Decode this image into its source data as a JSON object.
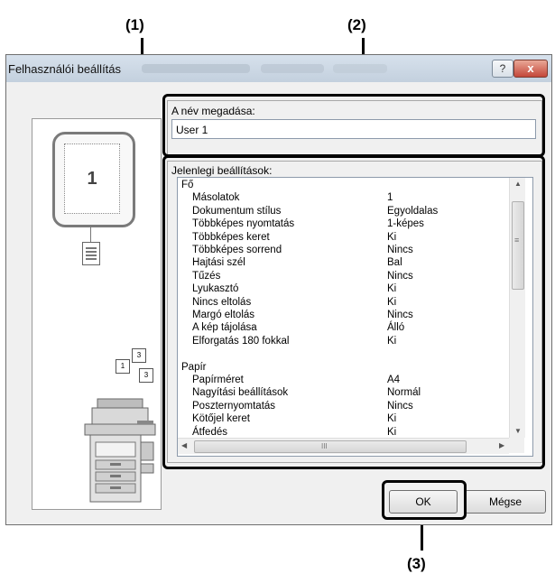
{
  "callouts": {
    "c1": "(1)",
    "c2": "(2)",
    "c3": "(3)"
  },
  "window": {
    "title": "Felhasználói beállítás",
    "help_glyph": "?",
    "close_glyph": "x"
  },
  "preview": {
    "page_number": "1"
  },
  "name_section": {
    "label": "A név megadása:",
    "value": "User 1"
  },
  "settings_section": {
    "label": "Jelenlegi beállítások:",
    "rows": [
      {
        "name": "Fő",
        "value": "",
        "indent": 0
      },
      {
        "name": "Másolatok",
        "value": "1",
        "indent": 1
      },
      {
        "name": "Dokumentum stílus",
        "value": "Egyoldalas",
        "indent": 1
      },
      {
        "name": "Többképes nyomtatás",
        "value": "1-képes",
        "indent": 1
      },
      {
        "name": "Többképes keret",
        "value": "Ki",
        "indent": 1
      },
      {
        "name": "Többképes sorrend",
        "value": "Nincs",
        "indent": 1
      },
      {
        "name": "Hajtási szél",
        "value": "Bal",
        "indent": 1
      },
      {
        "name": "Tűzés",
        "value": "Nincs",
        "indent": 1
      },
      {
        "name": "Lyukasztó",
        "value": "Ki",
        "indent": 1
      },
      {
        "name": "Nincs eltolás",
        "value": "Ki",
        "indent": 1
      },
      {
        "name": "Margó eltolás",
        "value": "Nincs",
        "indent": 1
      },
      {
        "name": "A kép tájolása",
        "value": "Álló",
        "indent": 1
      },
      {
        "name": "Elforgatás 180 fokkal",
        "value": "Ki",
        "indent": 1
      },
      {
        "name": "",
        "value": "",
        "indent": 0
      },
      {
        "name": "Papír",
        "value": "",
        "indent": 0
      },
      {
        "name": "Papírméret",
        "value": "A4",
        "indent": 1
      },
      {
        "name": "Nagyítási beállítások",
        "value": "Normál",
        "indent": 1
      },
      {
        "name": "Poszternyomtatás",
        "value": "Nincs",
        "indent": 1
      },
      {
        "name": "Kötőjel keret",
        "value": "Ki",
        "indent": 1
      },
      {
        "name": "Átfedés",
        "value": "Ki",
        "indent": 1
      }
    ],
    "hscroll_grip": "III"
  },
  "buttons": {
    "ok": "OK",
    "cancel": "Mégse"
  }
}
